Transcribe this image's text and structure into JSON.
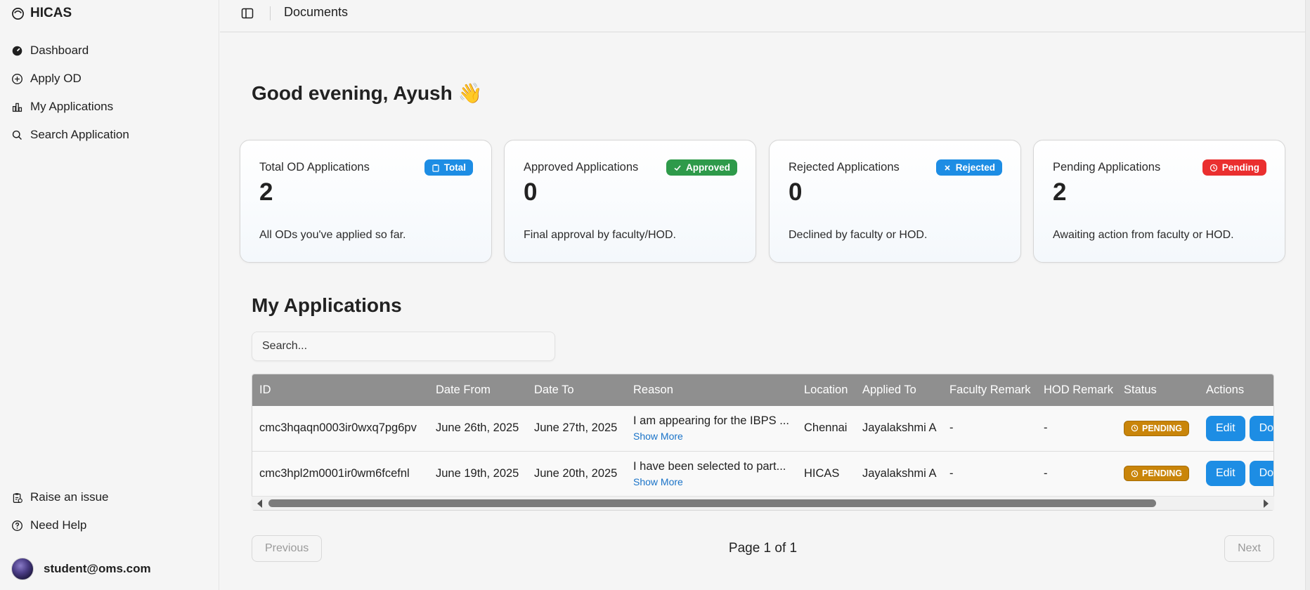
{
  "app": {
    "name": "HICAS"
  },
  "sidebar": {
    "items": [
      {
        "label": "Dashboard",
        "icon": "dashboard-icon"
      },
      {
        "label": "Apply OD",
        "icon": "plus-circle-icon"
      },
      {
        "label": "My Applications",
        "icon": "bar-chart-icon"
      },
      {
        "label": "Search Application",
        "icon": "search-icon"
      }
    ],
    "bottom_items": [
      {
        "label": "Raise an issue",
        "icon": "clipboard-icon"
      },
      {
        "label": "Need Help",
        "icon": "help-icon"
      }
    ],
    "user": {
      "email": "student@oms.com"
    }
  },
  "header": {
    "title": "Documents"
  },
  "greeting": "Good evening, Ayush 👋",
  "stats": [
    {
      "title": "Total OD Applications",
      "badge": "Total",
      "value": "2",
      "desc": "All ODs you've applied so far.",
      "color": "#1d8de4"
    },
    {
      "title": "Approved Applications",
      "badge": "Approved",
      "value": "0",
      "desc": "Final approval by faculty/HOD.",
      "color": "#2e9a4a"
    },
    {
      "title": "Rejected Applications",
      "badge": "Rejected",
      "value": "0",
      "desc": "Declined by faculty or HOD.",
      "color": "#1d8de4"
    },
    {
      "title": "Pending Applications",
      "badge": "Pending",
      "value": "2",
      "desc": "Awaiting action from faculty or HOD.",
      "color": "#ea2f2f"
    }
  ],
  "applications": {
    "title": "My Applications",
    "search_placeholder": "Search...",
    "columns": [
      "ID",
      "Date From",
      "Date To",
      "Reason",
      "Location",
      "Applied To",
      "Faculty Remark",
      "HOD Remark",
      "Status",
      "Actions"
    ],
    "rows": [
      {
        "id": "cmc3hqaqn0003ir0wxq7pg6pv",
        "from": "June 26th, 2025",
        "to": "June 27th, 2025",
        "reason": "I am appearing for the IBPS ...",
        "location": "Chennai",
        "applied_to": "Jayalakshmi A",
        "faculty_remark": "-",
        "hod_remark": "-",
        "status": "PENDING"
      },
      {
        "id": "cmc3hpl2m0001ir0wm6fcefnl",
        "from": "June 19th, 2025",
        "to": "June 20th, 2025",
        "reason": "I have been selected to part...",
        "location": "HICAS",
        "applied_to": "Jayalakshmi A",
        "faculty_remark": "-",
        "hod_remark": "-",
        "status": "PENDING"
      }
    ],
    "show_more": "Show More",
    "edit_label": "Edit",
    "download_label": "Do"
  },
  "pagination": {
    "previous": "Previous",
    "next": "Next",
    "info": "Page 1 of 1"
  }
}
